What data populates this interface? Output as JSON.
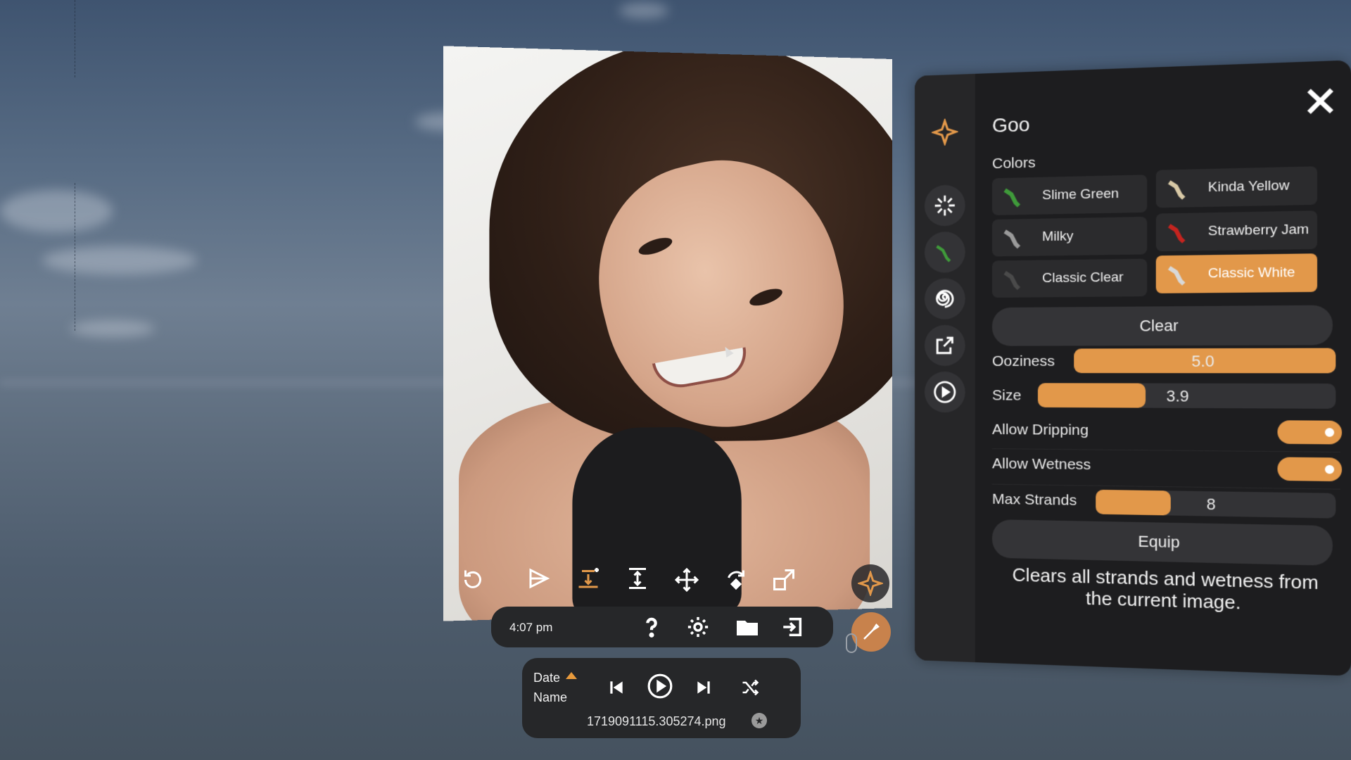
{
  "status_bar": {
    "time": "4:07 pm"
  },
  "player": {
    "sort_primary": "Date",
    "sort_secondary": "Name",
    "filename": "1719091115.305274.png"
  },
  "goo_panel": {
    "title": "Goo",
    "colors_label": "Colors",
    "colors": [
      {
        "label": "Slime Green",
        "swatch": "#3f9a3a",
        "selected": false
      },
      {
        "label": "Kinda Yellow",
        "swatch": "#d8c9a6",
        "selected": false
      },
      {
        "label": "Milky",
        "swatch": "#9a9a9a",
        "selected": false
      },
      {
        "label": "Strawberry Jam",
        "swatch": "#c4241f",
        "selected": false
      },
      {
        "label": "Classic Clear",
        "swatch": "#4a4a4a",
        "selected": false
      },
      {
        "label": "Classic White",
        "swatch": "#d8d8d8",
        "selected": true
      }
    ],
    "clear_label": "Clear",
    "ooziness": {
      "label": "Ooziness",
      "value": "5.0",
      "fraction": 1.0
    },
    "size": {
      "label": "Size",
      "value": "3.9",
      "fraction": 0.37
    },
    "allow_dripping": {
      "label": "Allow Dripping",
      "on": true
    },
    "allow_wetness": {
      "label": "Allow Wetness",
      "on": true
    },
    "max_strands": {
      "label": "Max Strands",
      "value": "8",
      "fraction": 0.32
    },
    "equip_label": "Equip",
    "description": "Clears all strands and wetness from the current image."
  },
  "colors": {
    "accent": "#e2984a",
    "panel_bg": "#1d1d1f",
    "button_bg": "#343437"
  }
}
